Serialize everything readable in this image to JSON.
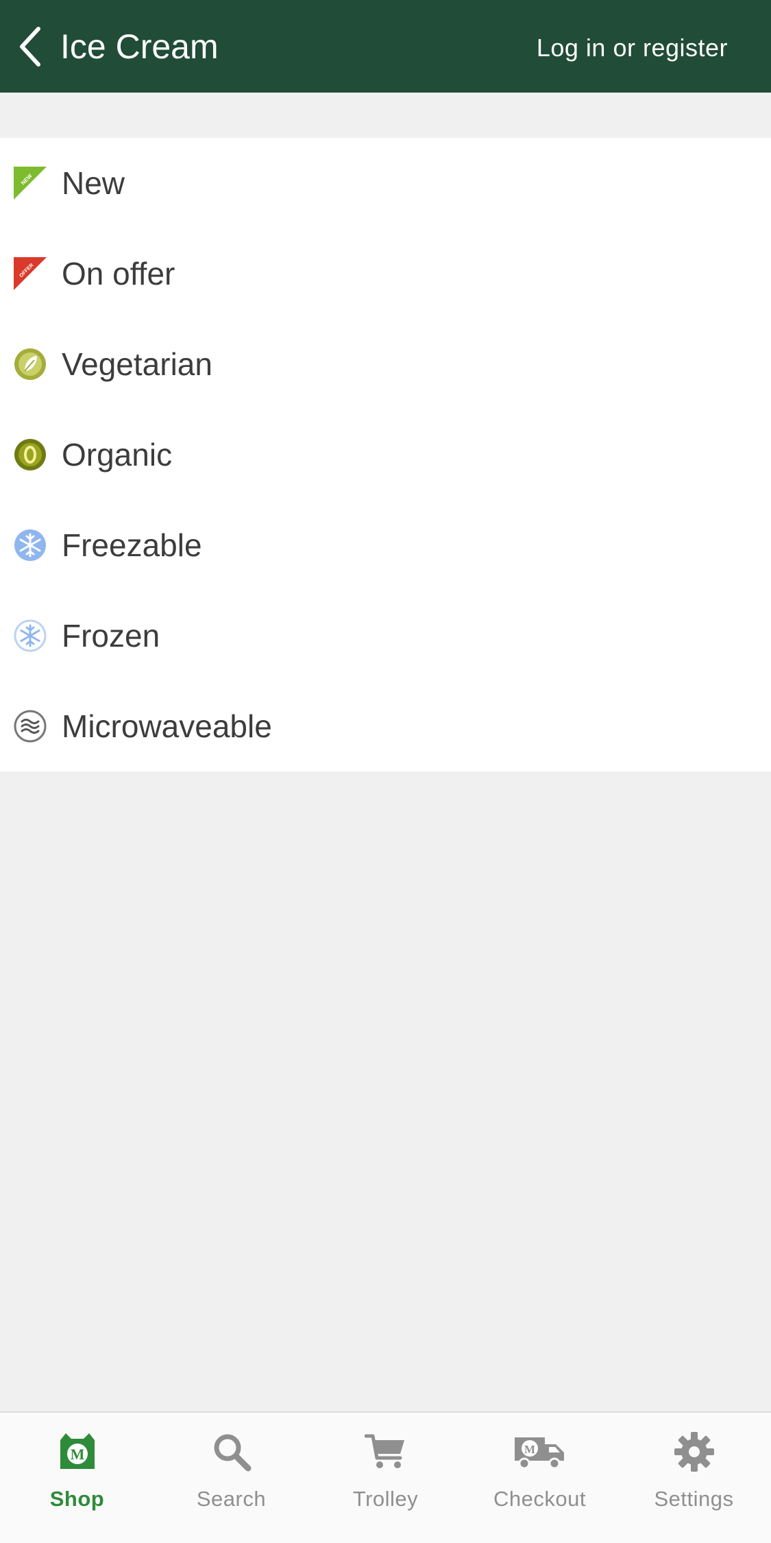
{
  "header": {
    "back_icon": "chevron-left-icon",
    "title": "Ice Cream",
    "login_label": "Log in or register",
    "background": "#214c38"
  },
  "filters": [
    {
      "label": "New",
      "icon": "new-badge-icon",
      "badge_text": "NEW",
      "color": "#7dbb2f"
    },
    {
      "label": "On offer",
      "icon": "offer-badge-icon",
      "badge_text": "OFFER",
      "color": "#d93a2b"
    },
    {
      "label": "Vegetarian",
      "icon": "leaf-icon",
      "color": "#a3ad3a"
    },
    {
      "label": "Organic",
      "icon": "organic-icon",
      "color": "#6f7a14"
    },
    {
      "label": "Freezable",
      "icon": "snowflake-filled-icon",
      "color": "#8fb6ef"
    },
    {
      "label": "Frozen",
      "icon": "snowflake-outline-icon",
      "color": "#8fb6ef"
    },
    {
      "label": "Microwaveable",
      "icon": "microwave-waves-icon",
      "color": "#777777"
    }
  ],
  "tabbar": {
    "active_color": "#2e8b3a",
    "inactive_color": "#8f8f8f",
    "tabs": [
      {
        "label": "Shop",
        "icon": "shop-bag-icon",
        "active": true
      },
      {
        "label": "Search",
        "icon": "search-icon",
        "active": false
      },
      {
        "label": "Trolley",
        "icon": "trolley-icon",
        "active": false
      },
      {
        "label": "Checkout",
        "icon": "delivery-van-icon",
        "active": false
      },
      {
        "label": "Settings",
        "icon": "gear-icon",
        "active": false
      }
    ]
  }
}
